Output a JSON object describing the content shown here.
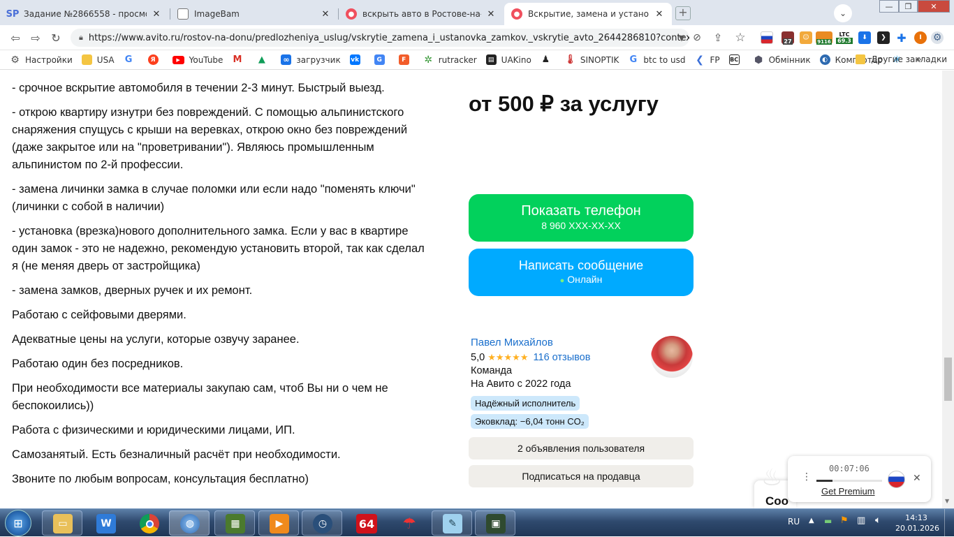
{
  "tabs": [
    {
      "title": "Задание №2866558 - просмотр з",
      "fav": "SP"
    },
    {
      "title": "ImageBam",
      "fav": ""
    },
    {
      "title": "вскрыть авто в Ростове-на-Дону",
      "fav": ""
    },
    {
      "title": "Вскрытие, замена и установка за",
      "fav": ""
    }
  ],
  "url": "https://www.avito.ru/rostov-na-donu/predlozheniya_uslug/vskrytie_zamena_i_ustanovka_zamkov._vskrytie_avto_2644286810?context...",
  "ext_badges": {
    "a": "27",
    "b": "9116",
    "c": "LTC",
    "d": "69.3",
    "e": "I"
  },
  "bookmarks": [
    {
      "label": "Настройки"
    },
    {
      "label": "USA"
    },
    {
      "label": ""
    },
    {
      "label": ""
    },
    {
      "label": "YouTube"
    },
    {
      "label": ""
    },
    {
      "label": ""
    },
    {
      "label": "загрузчик"
    },
    {
      "label": ""
    },
    {
      "label": ""
    },
    {
      "label": ""
    },
    {
      "label": "rutracker"
    },
    {
      "label": "UAKino"
    },
    {
      "label": ""
    },
    {
      "label": "SINOPTIK"
    },
    {
      "label": "btc to usd"
    },
    {
      "label": "FP"
    },
    {
      "label": ""
    },
    {
      "label": "Обмінник"
    },
    {
      "label": "Комп'ютер"
    },
    {
      "label": ""
    }
  ],
  "other_bookmarks": "Другие закладки",
  "description": [
    "- срочное вскрытие автомобиля в течении 2-3 минут. Быстрый выезд.",
    "- открою квартиру изнутри без повреждений. С помощью альпинистского снаряжения спущусь с крыши на веревках, открою окно без повреждений (даже закрытое или на \"проветривании\"). Являюсь промышленным альпинистом по 2-й профессии.",
    "- замена личинки замка в случае поломки или если надо \"поменять ключи\" (личинки с собой в наличии)",
    "- установка (врезка)нового дополнительного замка. Если у вас в квартире один замок - это не надежно, рекомендую установить второй, так как сделал я (не меняя дверь от застройщика)",
    "- замена замков, дверных ручек и их ремонт.",
    "Работаю с сейфовыми дверями.",
    "Адекватные цены на услуги, которые озвучу заранее.",
    "Работаю один без посредников.",
    "При необходимости все материалы закупаю сам, чтоб Вы ни о чем не беспокоились))",
    "Работа с физическими и юридическими лицами, ИП.",
    "Самозанятый. Есть безналичный расчёт при необходимости.",
    "Звоните по любым вопросам, консультация бесплатно)"
  ],
  "price": "от 500 ₽ за услугу",
  "phone_button": {
    "label": "Показать телефон",
    "number": "8 960 XXX-XX-XX",
    "color": "#02d15c"
  },
  "message_button": {
    "label": "Написать сообщение",
    "status": "Онлайн",
    "color": "#00aaff"
  },
  "seller": {
    "name": "Павел Михайлов",
    "rating": "5,0",
    "stars": "★★★★★",
    "reviews": "116 отзывов",
    "type": "Команда",
    "since": "На Авито с 2022 года",
    "badge1": "Надёжный исполнитель",
    "badge2": "Эковклад: −6,04 тонн CO₂",
    "ads_button": "2 объявления пользователя",
    "subscribe_button": "Подписаться на продавца"
  },
  "popup": {
    "timer": "00:07:06",
    "link": "Get Premium"
  },
  "behind_popup": "Соо",
  "taskbar": {
    "lang": "RU",
    "time": "14:13",
    "date": "20.01.2026",
    "app64": "64"
  }
}
